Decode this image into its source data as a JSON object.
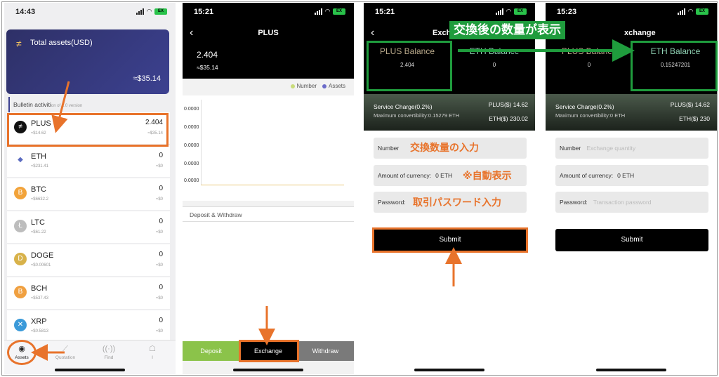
{
  "screens": {
    "assets": {
      "time": "14:43",
      "battery": "EX",
      "card_title": "Total assets(USD)",
      "card_amount": "≈$35.14",
      "bulletin": "Bulletin activiti",
      "bulletin_sub": "on of 2.0 version",
      "coins": [
        {
          "name": "PLUS",
          "price": "≈$14.62",
          "qty": "2.404",
          "value": "≈$35.14",
          "icon": "plus-coin-icon",
          "color": "#111111",
          "glyph": "≠"
        },
        {
          "name": "ETH",
          "price": "≈$231.41",
          "qty": "0",
          "value": "≈$0",
          "icon": "eth-coin-icon",
          "color": "#ffffff",
          "glyph": "◆"
        },
        {
          "name": "BTC",
          "price": "≈$6632.2",
          "qty": "0",
          "value": "≈$0",
          "icon": "btc-coin-icon",
          "color": "#f2a33a",
          "glyph": "B"
        },
        {
          "name": "LTC",
          "price": "≈$61.22",
          "qty": "0",
          "value": "≈$0",
          "icon": "ltc-coin-icon",
          "color": "#bdbdbd",
          "glyph": "Ł"
        },
        {
          "name": "DOGE",
          "price": "≈$0.00601",
          "qty": "0",
          "value": "≈$0",
          "icon": "doge-coin-icon",
          "color": "#d8b24a",
          "glyph": "D"
        },
        {
          "name": "BCH",
          "price": "≈$537.43",
          "qty": "0",
          "value": "≈$0",
          "icon": "bch-coin-icon",
          "color": "#f0a040",
          "glyph": "B"
        },
        {
          "name": "XRP",
          "price": "≈$0.5813",
          "qty": "0",
          "value": "≈$0",
          "icon": "xrp-coin-icon",
          "color": "#3b9ad9",
          "glyph": "✕"
        }
      ],
      "tabs": [
        {
          "label": "Assets",
          "icon": "assets-icon"
        },
        {
          "label": "Quotation",
          "icon": "quotation-icon"
        },
        {
          "label": "Find",
          "icon": "find-icon"
        },
        {
          "label": "I",
          "icon": "profile-icon"
        }
      ]
    },
    "detail": {
      "time": "15:21",
      "title": "PLUS",
      "balance": "2.404",
      "usd": "≈$35.14",
      "legend_number": "Number",
      "legend_assets": "Assets",
      "ticks": [
        "0.0000",
        "0.0000",
        "0.0000",
        "0.0000",
        "0.0000"
      ],
      "section": "Deposit & Withdraw",
      "deposit": "Deposit",
      "exchange": "Exchange",
      "withdraw": "Withdraw",
      "colors": {
        "number": "#c9dc7a",
        "assets": "#6b6bc9"
      }
    },
    "exchange_before": {
      "time": "15:21",
      "title": "Exchan",
      "plus_label": "PLUS Balance",
      "plus_value": "2.404",
      "eth_label": "ETH Balance",
      "eth_value": "0",
      "charge": "Service Charge(0.2%)",
      "max": "Maximum convertibility:0.15279 ETH",
      "plus_price": "PLUS($) 14.62",
      "eth_price": "ETH($) 230.02",
      "number_label": "Number",
      "currency_label": "Amount of currency:",
      "currency_value": "0 ETH",
      "password_label": "Password:",
      "submit": "Submit"
    },
    "exchange_after": {
      "time": "15:23",
      "title": "xchange",
      "plus_label": "PLUS Balance",
      "plus_value": "0",
      "eth_label": "ETH Balance",
      "eth_value": "0.15247201",
      "charge": "Service Charge(0.2%)",
      "max": "Maximum convertibility:0 ETH",
      "plus_price": "PLUS($) 14.62",
      "eth_price": "ETH($) 230",
      "number_label": "Number",
      "number_placeholder": "Exchange quantity",
      "currency_label": "Amount of currency:",
      "currency_value": "0 ETH",
      "password_label": "Password:",
      "password_placeholder": "Transaction password",
      "submit": "Submit"
    }
  },
  "annotations": {
    "top": "交換後の数量が表示",
    "quantity": "交換数量の入力",
    "auto": "※自動表示",
    "password": "取引パスワード入力",
    "orange": "#e8732b",
    "green": "#1f9c3d"
  }
}
